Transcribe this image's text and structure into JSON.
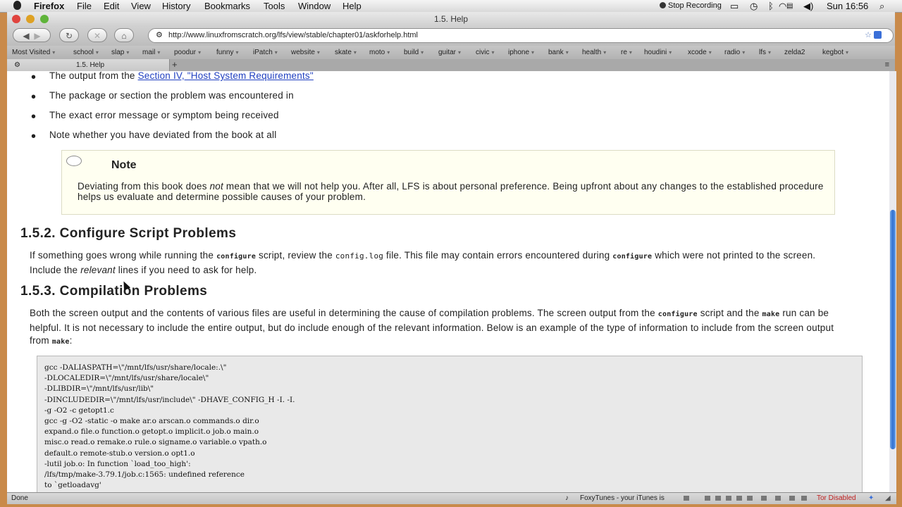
{
  "menubar": {
    "app": "Firefox",
    "items": [
      "File",
      "Edit",
      "View",
      "History",
      "Bookmarks",
      "Tools",
      "Window",
      "Help"
    ],
    "recording": "Stop Recording",
    "clock": "Sun 16:56"
  },
  "window": {
    "title": "1.5. Help"
  },
  "toolbar": {
    "url": "http://www.linuxfromscratch.org/lfs/view/stable/chapter01/askforhelp.html"
  },
  "bookmarks": [
    "Most Visited",
    "school",
    "slap",
    "mail",
    "poodur",
    "funny",
    "iPatch",
    "website",
    "skate",
    "moto",
    "build",
    "guitar",
    "civic",
    "iphone",
    "bank",
    "health",
    "re",
    "houdini",
    "xcode",
    "radio",
    "lfs",
    "zelda2",
    "kegbot"
  ],
  "tabs": {
    "active": "1.5. Help",
    "new_tab": "+"
  },
  "page": {
    "list_first_prefix": "The output from the ",
    "list_first_link": "Section IV, \"Host System Requirements\"",
    "list_items": [
      "The package or section the problem was encountered in",
      "The exact error message or symptom being received",
      "Note whether you have deviated from the book at all"
    ],
    "note": {
      "title": "Note",
      "body_1": "Deviating from this book does ",
      "body_em": "not",
      "body_2": " mean that we will not help you. After all, LFS is about personal preference. Being upfront about any changes to the established procedure helps us evaluate and determine possible causes of your problem."
    },
    "section_152": {
      "heading": "1.5.2. Configure Script Problems",
      "p1": "If something goes wrong while running the ",
      "c1": "configure",
      "p2": " script, review the ",
      "c2": "config.log",
      "p3": " file. This file may contain errors encountered during ",
      "c3": "configure",
      "p4": " which were not printed to the screen. Include the ",
      "em": "relevant",
      "p5": " lines if you need to ask for help."
    },
    "section_153": {
      "heading": "1.5.3. Compilation Problems",
      "p1": "Both the screen output and the contents of various files are useful in determining the cause of compilation problems. The screen output from the ",
      "c1": "configure",
      "p2": " script and the ",
      "c2": "make",
      "p3": " run can be helpful. It is not necessary to include the entire output, but do include enough of the relevant information. Below is an example of the type of information to include from the screen output from ",
      "c3": "make",
      "p4": ":"
    },
    "code_lines": [
      "gcc -DALIASPATH=\\\"/mnt/lfs/usr/share/locale:.\\\"",
      "-DLOCALEDIR=\\\"/mnt/lfs/usr/share/locale\\\"",
      "-DLIBDIR=\\\"/mnt/lfs/usr/lib\\\"",
      "-DINCLUDEDIR=\\\"/mnt/lfs/usr/include\\\" -DHAVE_CONFIG_H -I. -I.",
      "-g -O2 -c getopt1.c",
      "gcc -g -O2 -static -o make ar.o arscan.o commands.o dir.o",
      "expand.o file.o function.o getopt.o implicit.o job.o main.o",
      "misc.o read.o remake.o rule.o signame.o variable.o vpath.o",
      "default.o remote-stub.o version.o opt1.o",
      "-lutil job.o: In function `load_too_high':",
      "/lfs/tmp/make-3.79.1/job.c:1565: undefined reference",
      "to `getloadavg'"
    ]
  },
  "statusbar": {
    "status": "Done",
    "foxytunes": "FoxyTunes - your iTunes is",
    "tor": "Tor Disabled"
  },
  "colors": {
    "link": "#2040c0",
    "tor": "#c02020",
    "note_bg": "#fffff1",
    "scroll_thumb": "#2f6fd0"
  }
}
